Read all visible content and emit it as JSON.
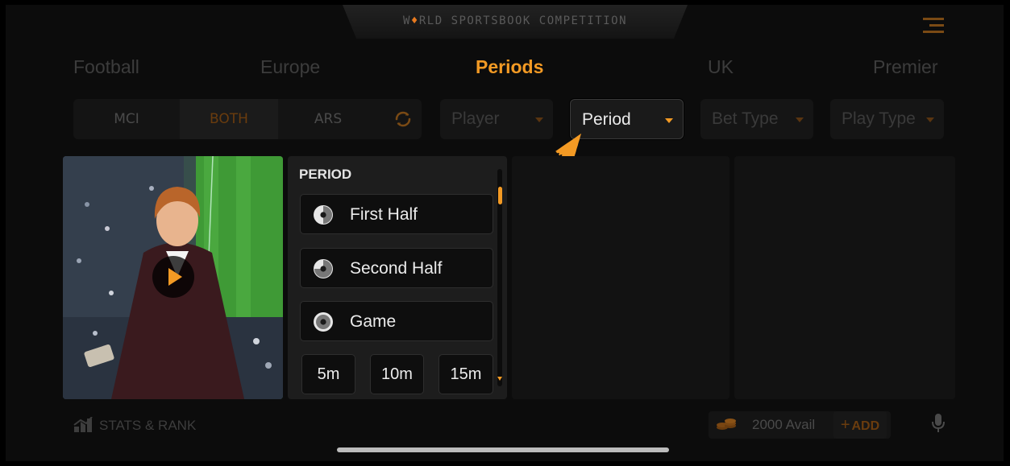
{
  "header": {
    "title_pre": "W",
    "title_accent": "♦",
    "title_post": "RLD SPORTSBOOK COMPETITION",
    "menu_icon": "hamburger-menu-icon"
  },
  "categories": [
    {
      "label": "Football"
    },
    {
      "label": "Europe"
    },
    {
      "label": "Periods",
      "active": true
    },
    {
      "label": "UK"
    },
    {
      "label": "Premier"
    }
  ],
  "teams": [
    {
      "label": "MCI"
    },
    {
      "label": "BOTH",
      "selected": true
    },
    {
      "label": "ARS"
    }
  ],
  "filters": [
    {
      "label": "Player"
    },
    {
      "label": "Period",
      "active": true
    },
    {
      "label": "Bet Type"
    },
    {
      "label": "Play Type"
    }
  ],
  "video": {
    "play_icon": "play-icon"
  },
  "period_panel": {
    "title": "PERIOD",
    "options": [
      {
        "label": "First Half",
        "icon": "half-clock-icon"
      },
      {
        "label": "Second Half",
        "icon": "three-quarter-clock-icon"
      },
      {
        "label": "Game",
        "icon": "clock-icon"
      }
    ],
    "chips": [
      "5m",
      "10m",
      "15m"
    ]
  },
  "footer": {
    "stats_label": "STATS & RANK",
    "balance": "2000 Avail",
    "add_label": "ADD",
    "mic_icon": "microphone-icon"
  },
  "colors": {
    "accent": "#f39a24",
    "background": "#0c0c0c"
  }
}
